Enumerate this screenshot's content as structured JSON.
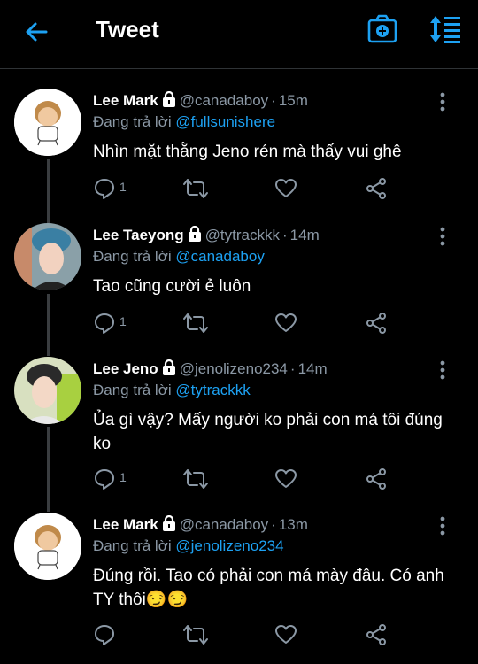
{
  "header": {
    "title": "Tweet"
  },
  "reply_prefix": "Đang trả lời",
  "tweets": [
    {
      "name": "Lee Mark",
      "handle": "@canadaboy",
      "time": "15m",
      "reply_to": "@fullsunishere",
      "text": "Nhìn mặt thằng Jeno rén mà thấy vui ghê",
      "reply_count": "1"
    },
    {
      "name": "Lee Taeyong",
      "handle": "@tytrackkk",
      "time": "14m",
      "reply_to": "@canadaboy",
      "text": "Tao cũng cười ẻ luôn",
      "reply_count": "1"
    },
    {
      "name": "Lee Jeno",
      "handle": "@jenolizeno234",
      "time": "14m",
      "reply_to": "@tytrackkk",
      "text": "Ủa gì vậy? Mấy người ko phải con má tôi đúng ko",
      "reply_count": "1"
    },
    {
      "name": "Lee Mark",
      "handle": "@canadaboy",
      "time": "13m",
      "reply_to": "@jenolizeno234",
      "text": "Đúng rồi. Tao có  phải con má mày đâu. Có anh TY thôi😏😏",
      "reply_count": ""
    }
  ],
  "colors": {
    "accent": "#1da1f2",
    "muted": "#8b98a5",
    "background": "#000000"
  }
}
